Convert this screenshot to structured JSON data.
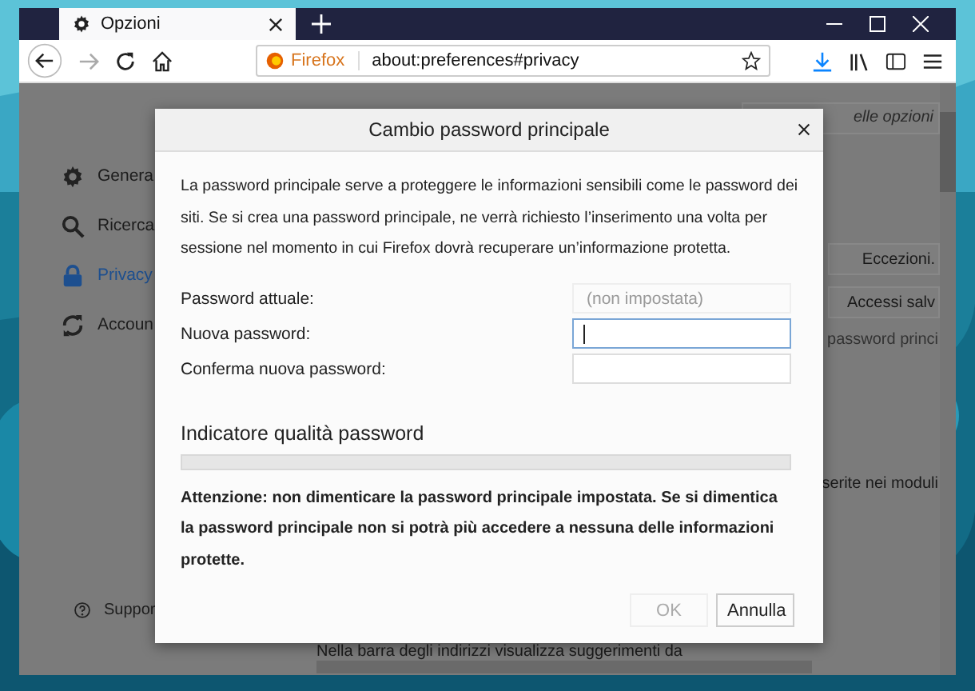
{
  "browser": {
    "tab": {
      "title": "Opzioni",
      "selected": true
    },
    "url_site": "Firefox",
    "url": "about:preferences#privacy"
  },
  "sidebar": {
    "items": [
      {
        "label": "Genera",
        "kind": "gear",
        "selected": false
      },
      {
        "label": "Ricerca",
        "kind": "search",
        "selected": false
      },
      {
        "label": "Privacy",
        "kind": "lock",
        "selected": true
      },
      {
        "label": "Accoun",
        "kind": "sync",
        "selected": false
      }
    ],
    "support": "Suppor"
  },
  "page": {
    "search_placeholder": "elle opzioni",
    "buttons": [
      "Eccezioni.",
      "Accessi salv"
    ],
    "link": "password princi",
    "text_1": "serite nei moduli",
    "text_2": "Nella barra degli indirizzi visualizza suggerimenti da"
  },
  "dialog": {
    "title": "Cambio password principale",
    "description": "La password principale serve a proteggere le informazioni sensibili come le password dei siti. Se si crea una password principale, ne verrà richiesto l’inserimento una volta per sessione nel momento in cui Firefox dovrà recuperare un’informazione protetta.",
    "fields": [
      {
        "label": "Password attuale:",
        "value": "(non impostata)",
        "disabled": true,
        "focused": false
      },
      {
        "label": "Nuova password:",
        "disabled": false,
        "focused": true
      },
      {
        "label": "Conferma nuova password:",
        "disabled": false,
        "focused": false
      }
    ],
    "meter": {
      "title": "Indicatore qualità password",
      "level": 0
    },
    "warning": "Attenzione: non dimenticare la password principale impostata. Se si dimentica la password principale non si potrà più accedere a nessuna delle informazioni protette.",
    "buttons": [
      {
        "label": "OK",
        "disabled": true
      },
      {
        "label": "Annulla",
        "disabled": false
      }
    ]
  }
}
